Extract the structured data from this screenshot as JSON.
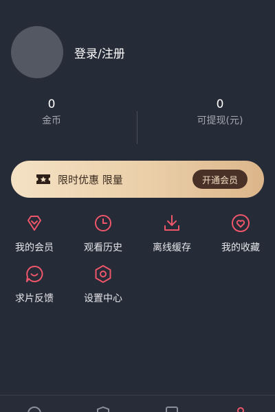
{
  "profile": {
    "login_label": "登录/注册"
  },
  "stats": {
    "coins_value": "0",
    "coins_label": "金币",
    "withdraw_value": "0",
    "withdraw_label": "可提现(元)"
  },
  "vip_banner": {
    "text": "限时优惠 限量",
    "button_label": "开通会员"
  },
  "menu": {
    "items": [
      {
        "label": "我的会员",
        "icon": "diamond-icon"
      },
      {
        "label": "观看历史",
        "icon": "clock-icon"
      },
      {
        "label": "离线缓存",
        "icon": "download-icon"
      },
      {
        "label": "我的收藏",
        "icon": "heart-icon"
      },
      {
        "label": "求片反馈",
        "icon": "chat-bubble-icon"
      },
      {
        "label": "设置中心",
        "icon": "settings-hexagon-icon"
      }
    ]
  },
  "colors": {
    "background": "#262b38",
    "accent": "#f0566a",
    "vip_gold": "#eacfa8",
    "vip_button": "#4a3128"
  }
}
